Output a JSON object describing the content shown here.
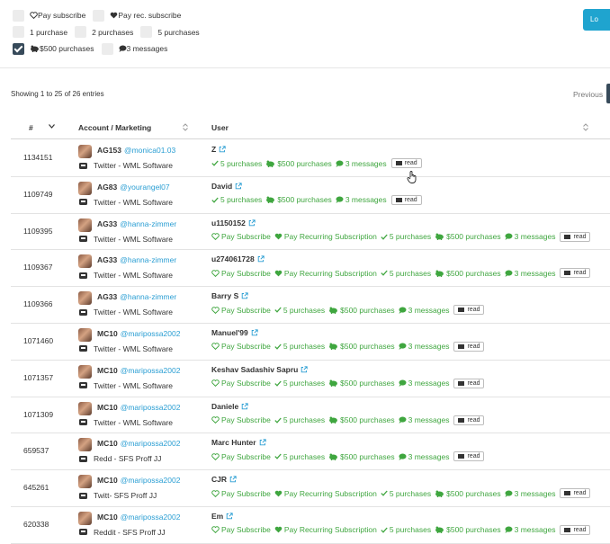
{
  "filters": {
    "row1": [
      "Pay subscribe",
      "Pay rec. subscribe"
    ],
    "row2": [
      "1 purchase",
      "2 purchases",
      "5 purchases"
    ],
    "row3": [
      "$500 purchases",
      "3 messages"
    ]
  },
  "load_button": "Lo",
  "showing_text": "Showing 1 to 25 of 26 entries",
  "previous_label": "Previous",
  "columns": {
    "id": "#",
    "account": "Account / Marketing",
    "user": "User"
  },
  "tag_labels": {
    "pay_sub": "Pay Subscribe",
    "pay_rec": "Pay Recurring Subscription",
    "five_purch": "5 purchases",
    "usd500": "$500 purchases",
    "three_msg": "3 messages",
    "read": "read"
  },
  "rows": [
    {
      "id": "1134151",
      "acc": "AG153",
      "handle": "@monica01.03",
      "marketing": "Twitter - WML Software",
      "user": "Z"
    },
    {
      "id": "1109749",
      "acc": "AG83",
      "handle": "@yourangel07",
      "marketing": "Twitter - WML Software",
      "user": "David"
    },
    {
      "id": "1109395",
      "acc": "AG33",
      "handle": "@hanna-zimmer",
      "marketing": "Twitter - WML Software",
      "user": "u1150152"
    },
    {
      "id": "1109367",
      "acc": "AG33",
      "handle": "@hanna-zimmer",
      "marketing": "Twitter - WML Software",
      "user": "u274061728"
    },
    {
      "id": "1109366",
      "acc": "AG33",
      "handle": "@hanna-zimmer",
      "marketing": "Twitter - WML Software",
      "user": "Barry S"
    },
    {
      "id": "1071460",
      "acc": "MC10",
      "handle": "@maripossa2002",
      "marketing": "Twitter - WML Software",
      "user": "Manuel'99"
    },
    {
      "id": "1071357",
      "acc": "MC10",
      "handle": "@maripossa2002",
      "marketing": "Twitter - WML Software",
      "user": "Keshav Sadashiv Sapru"
    },
    {
      "id": "1071309",
      "acc": "MC10",
      "handle": "@maripossa2002",
      "marketing": "Twitter - WML Software",
      "user": "Daniele"
    },
    {
      "id": "659537",
      "acc": "MC10",
      "handle": "@maripossa2002",
      "marketing": "Redd - SFS Proff JJ",
      "user": "Marc Hunter"
    },
    {
      "id": "645261",
      "acc": "MC10",
      "handle": "@maripossa2002",
      "marketing": "Twitt- SFS Proff JJ",
      "user": "CJR"
    },
    {
      "id": "620338",
      "acc": "MC10",
      "handle": "@maripossa2002",
      "marketing": "Reddit - SFS Proff JJ",
      "user": "Em"
    }
  ],
  "colors": {
    "accent": "#1fa4cf",
    "tag_green": "#3fa63f",
    "link_blue": "#2a9ed3",
    "checkbox_dark": "#374a5a"
  }
}
